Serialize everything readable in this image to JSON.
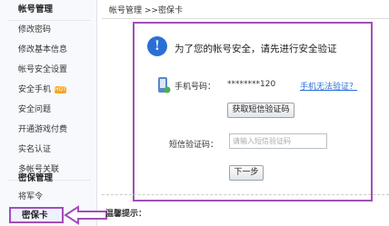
{
  "sidebar": {
    "heading1": "帐号管理",
    "items": [
      "修改密码",
      "修改基本信息",
      "帐号安全设置",
      "安全手机",
      "安全问题",
      "开通游戏付费",
      "实名认证",
      "多帐号关联"
    ],
    "hot_badge": "HOT",
    "heading2": "密保管理",
    "items2": [
      "将军令"
    ],
    "active": "密保卡"
  },
  "breadcrumb": "帐号管理 >>密保卡",
  "panel": {
    "title": "为了您的帐号安全，请先进行安全验证",
    "phone_label": "手机号码：",
    "phone_value": "********120",
    "phone_link": "手机无法验证？",
    "get_code_button": "获取短信验证码",
    "code_label": "短信验证码：",
    "code_placeholder": "请输入短信验证码",
    "next_button": "下一步"
  },
  "tips": {
    "title": "温馨提示："
  },
  "colors": {
    "highlight": "#a24fb7",
    "info": "#2b6fd6"
  }
}
